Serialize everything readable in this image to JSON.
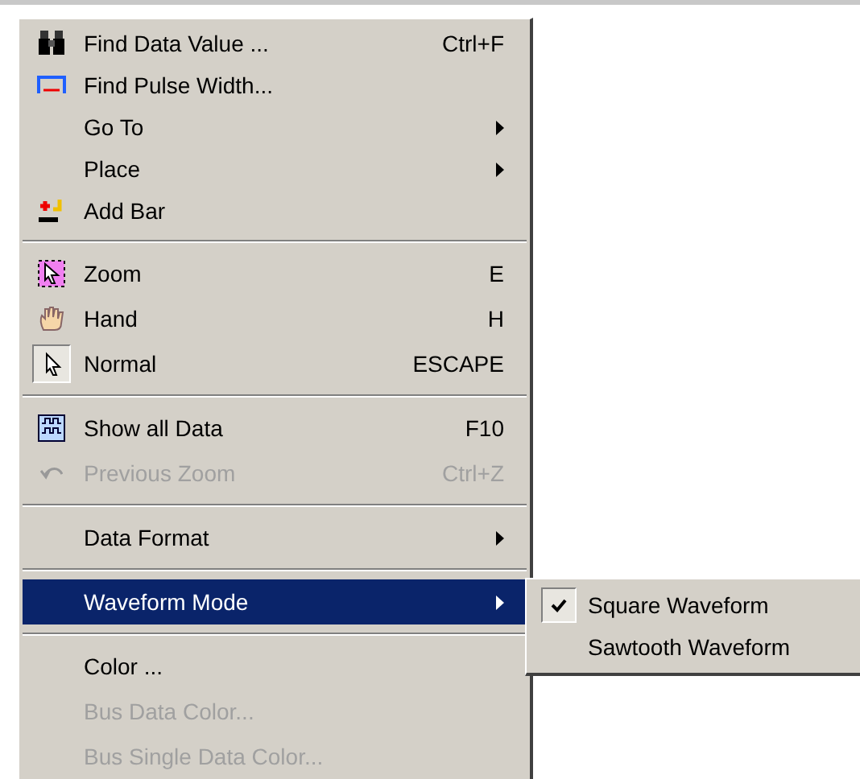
{
  "menu": {
    "entries": [
      {
        "kind": "item",
        "label": "Find Data Value ...",
        "shortcut": "Ctrl+F",
        "submenu": false,
        "disabled": false,
        "checked": false,
        "selected": false
      },
      {
        "kind": "item",
        "label": "Find Pulse Width...",
        "submenu": false,
        "disabled": false,
        "checked": false,
        "selected": false
      },
      {
        "kind": "item",
        "label": "Go To",
        "submenu": true,
        "disabled": false,
        "checked": false,
        "selected": false
      },
      {
        "kind": "item",
        "label": "Place",
        "submenu": true,
        "disabled": false,
        "checked": false,
        "selected": false
      },
      {
        "kind": "item",
        "label": "Add Bar",
        "submenu": false,
        "disabled": false,
        "checked": false,
        "selected": false
      },
      {
        "kind": "separator"
      },
      {
        "kind": "item",
        "label": "Zoom",
        "shortcut": "E",
        "submenu": false,
        "disabled": false,
        "checked": false,
        "selected": false
      },
      {
        "kind": "item",
        "label": "Hand",
        "shortcut": "H",
        "submenu": false,
        "disabled": false,
        "checked": false,
        "selected": false
      },
      {
        "kind": "item",
        "label": "Normal",
        "shortcut": "ESCAPE",
        "submenu": false,
        "disabled": false,
        "checked": true,
        "selected": false
      },
      {
        "kind": "separator"
      },
      {
        "kind": "item",
        "label": "Show all Data",
        "shortcut": "F10",
        "submenu": false,
        "disabled": false,
        "checked": false,
        "selected": false
      },
      {
        "kind": "item",
        "label": "Previous Zoom",
        "shortcut": "Ctrl+Z",
        "submenu": false,
        "disabled": true,
        "checked": false,
        "selected": false
      },
      {
        "kind": "separator"
      },
      {
        "kind": "item",
        "label": "Data Format",
        "submenu": true,
        "disabled": false,
        "checked": false,
        "selected": false
      },
      {
        "kind": "separator"
      },
      {
        "kind": "item",
        "label": "Waveform Mode",
        "submenu": true,
        "disabled": false,
        "checked": false,
        "selected": true
      },
      {
        "kind": "separator"
      },
      {
        "kind": "item",
        "label": "Color ...",
        "submenu": false,
        "disabled": false,
        "checked": false,
        "selected": false
      },
      {
        "kind": "item",
        "label": "Bus Data Color...",
        "submenu": false,
        "disabled": true,
        "checked": false,
        "selected": false
      },
      {
        "kind": "item",
        "label": "Bus Single Data Color...",
        "submenu": false,
        "disabled": true,
        "checked": false,
        "selected": false
      }
    ]
  },
  "submenu": {
    "items": [
      {
        "label": "Square Waveform",
        "checked": true
      },
      {
        "label": "Sawtooth Waveform",
        "checked": false
      }
    ]
  }
}
